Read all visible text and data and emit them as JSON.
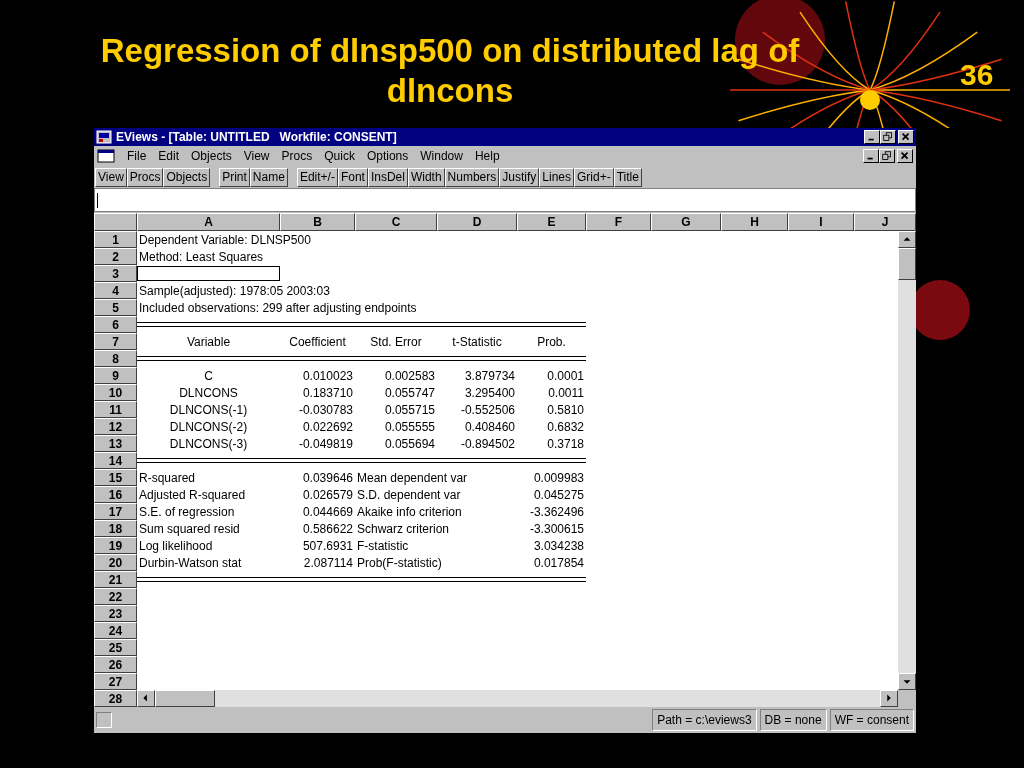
{
  "slide": {
    "title": "Regression of dlnsp500 on distributed lag of dlncons",
    "number": "36"
  },
  "window": {
    "title": "EViews - [Table: UNTITLED   Workfile: CONSENT]",
    "menu": [
      "File",
      "Edit",
      "Objects",
      "View",
      "Procs",
      "Quick",
      "Options",
      "Window",
      "Help"
    ],
    "toolbar": [
      [
        "View",
        "Procs",
        "Objects"
      ],
      [
        "Print",
        "Name"
      ],
      [
        "Edit+/-",
        "Font",
        "InsDel",
        "Width",
        "Numbers",
        "Justify",
        "Lines",
        "Grid+-",
        "Title"
      ]
    ]
  },
  "columns": [
    "A",
    "B",
    "C",
    "D",
    "E",
    "F",
    "G",
    "H",
    "I",
    "J"
  ],
  "rows": [
    {
      "number": "1",
      "kind": "text",
      "selected": false,
      "cells": [
        "Dependent Variable: DLNSP500"
      ]
    },
    {
      "number": "2",
      "kind": "text",
      "selected": false,
      "cells": [
        "Method: Least Squares"
      ]
    },
    {
      "number": "3",
      "kind": "empty",
      "selected": true,
      "cells": []
    },
    {
      "number": "4",
      "kind": "text",
      "selected": false,
      "cells": [
        "Sample(adjusted): 1978:05 2003:03"
      ]
    },
    {
      "number": "5",
      "kind": "text",
      "selected": false,
      "cells": [
        "Included observations: 299 after adjusting endpoints"
      ]
    },
    {
      "number": "6",
      "kind": "rule",
      "selected": false,
      "cells": []
    },
    {
      "number": "7",
      "kind": "header",
      "selected": false,
      "cells": [
        "Variable",
        "Coefficient",
        "Std. Error",
        "t-Statistic",
        "Prob."
      ]
    },
    {
      "number": "8",
      "kind": "rule",
      "selected": false,
      "cells": []
    },
    {
      "number": "9",
      "kind": "coef",
      "selected": false,
      "cells": [
        "C",
        "0.010023",
        "0.002583",
        "3.879734",
        "0.0001"
      ]
    },
    {
      "number": "10",
      "kind": "coef",
      "selected": false,
      "cells": [
        "DLNCONS",
        "0.183710",
        "0.055747",
        "3.295400",
        "0.0011"
      ]
    },
    {
      "number": "11",
      "kind": "coef",
      "selected": false,
      "cells": [
        "DLNCONS(-1)",
        "-0.030783",
        "0.055715",
        "-0.552506",
        "0.5810"
      ]
    },
    {
      "number": "12",
      "kind": "coef",
      "selected": false,
      "cells": [
        "DLNCONS(-2)",
        "0.022692",
        "0.055555",
        "0.408460",
        "0.6832"
      ]
    },
    {
      "number": "13",
      "kind": "coef",
      "selected": false,
      "cells": [
        "DLNCONS(-3)",
        "-0.049819",
        "0.055694",
        "-0.894502",
        "0.3718"
      ]
    },
    {
      "number": "14",
      "kind": "rule",
      "selected": false,
      "cells": []
    },
    {
      "number": "15",
      "kind": "stats",
      "selected": false,
      "cells": [
        "R-squared",
        "0.039646",
        "Mean dependent var",
        "0.009983"
      ]
    },
    {
      "number": "16",
      "kind": "stats",
      "selected": false,
      "cells": [
        "Adjusted R-squared",
        "0.026579",
        "S.D. dependent var",
        "0.045275"
      ]
    },
    {
      "number": "17",
      "kind": "stats",
      "selected": false,
      "cells": [
        "S.E. of regression",
        "0.044669",
        "Akaike info criterion",
        "-3.362496"
      ]
    },
    {
      "number": "18",
      "kind": "stats",
      "selected": false,
      "cells": [
        "Sum squared resid",
        "0.586622",
        "Schwarz criterion",
        "-3.300615"
      ]
    },
    {
      "number": "19",
      "kind": "stats",
      "selected": false,
      "cells": [
        "Log likelihood",
        "507.6931",
        "F-statistic",
        "3.034238"
      ]
    },
    {
      "number": "20",
      "kind": "stats",
      "selected": false,
      "cells": [
        "Durbin-Watson stat",
        "2.087114",
        "Prob(F-statistic)",
        "0.017854"
      ]
    },
    {
      "number": "21",
      "kind": "rule",
      "selected": false,
      "cells": []
    },
    {
      "number": "22",
      "kind": "empty",
      "selected": false,
      "cells": []
    },
    {
      "number": "23",
      "kind": "empty",
      "selected": false,
      "cells": []
    },
    {
      "number": "24",
      "kind": "empty",
      "selected": false,
      "cells": []
    },
    {
      "number": "25",
      "kind": "empty",
      "selected": false,
      "cells": []
    },
    {
      "number": "26",
      "kind": "empty",
      "selected": false,
      "cells": []
    },
    {
      "number": "27",
      "kind": "empty",
      "selected": false,
      "cells": []
    },
    {
      "number": "28",
      "kind": "empty",
      "selected": false,
      "cells": []
    }
  ],
  "status_bar": [
    "Path = c:\\eviews3",
    "DB = none",
    "WF = consent"
  ]
}
